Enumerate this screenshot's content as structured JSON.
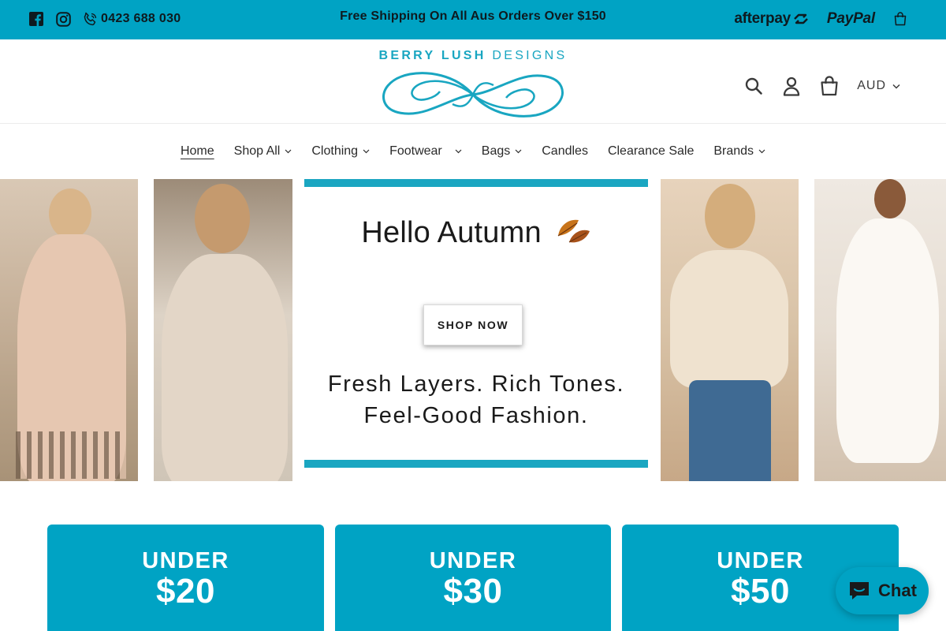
{
  "topbar": {
    "phone": "0423 688 030",
    "promo": "Free Shipping On All Aus Orders Over $150",
    "afterpay": "afterpay",
    "paypal": "PayPal",
    "color": "#00a3c4"
  },
  "header": {
    "logo_text_bold": "BERRY LUSH",
    "logo_text_light": "DESIGNS",
    "currency": "AUD",
    "logo_color": "#19a6c1"
  },
  "nav": {
    "items": [
      {
        "label": "Home"
      },
      {
        "label": "Shop All"
      },
      {
        "label": "Clothing"
      },
      {
        "label": "Footwear"
      },
      {
        "label": "Bags"
      },
      {
        "label": "Candles"
      },
      {
        "label": "Clearance Sale"
      },
      {
        "label": "Brands"
      }
    ]
  },
  "hero": {
    "title": "Hello Autumn",
    "tagline_1": "Fresh Layers. Rich Tones.",
    "tagline_2": "Feel-Good Fashion.",
    "cta": "SHOP NOW"
  },
  "price_cards": [
    {
      "label": "UNDER",
      "amount": "$20"
    },
    {
      "label": "UNDER",
      "amount": "$30"
    },
    {
      "label": "UNDER",
      "amount": "$50"
    }
  ],
  "chat": {
    "label": "Chat"
  }
}
